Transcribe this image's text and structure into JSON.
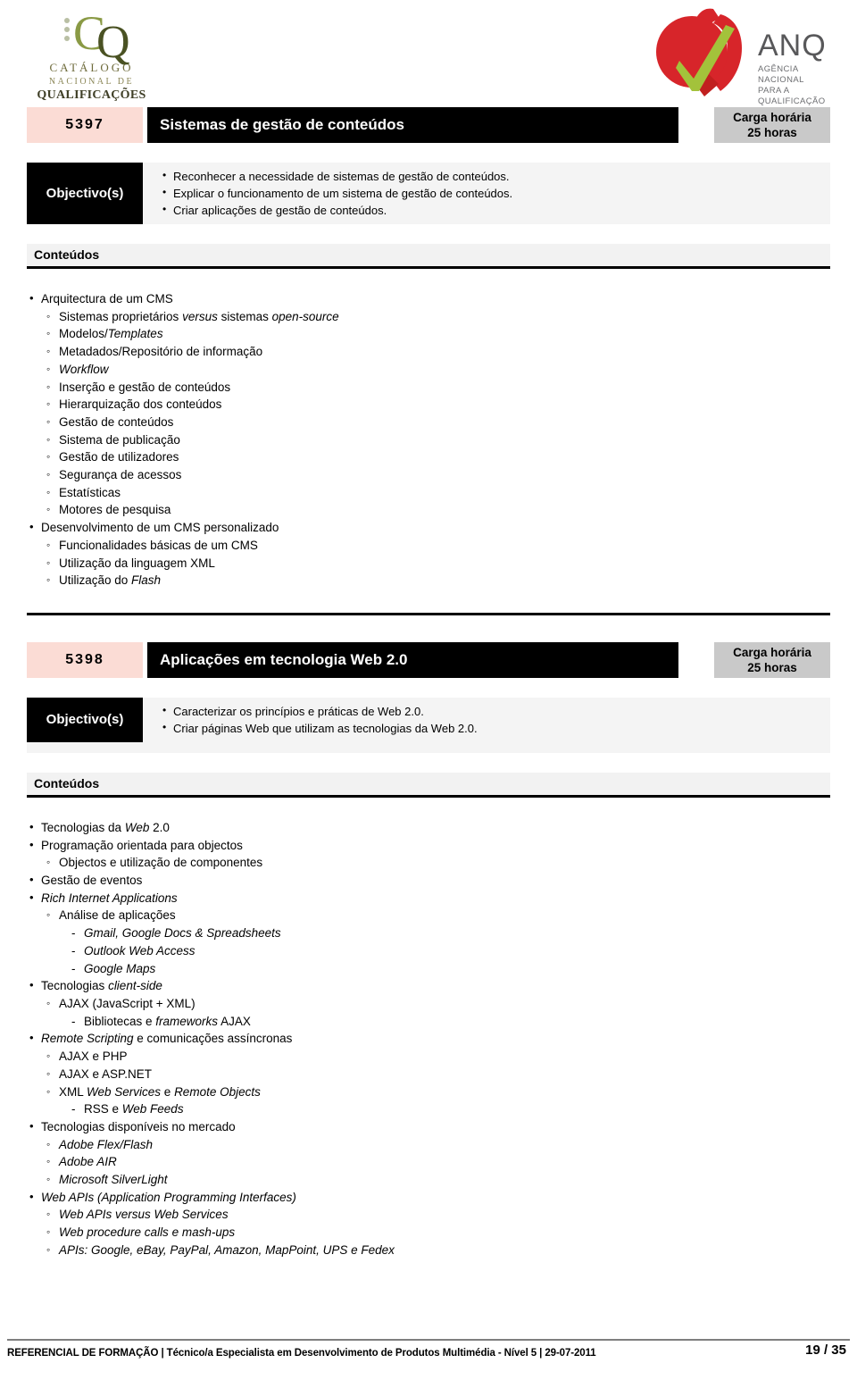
{
  "header": {
    "cnq_logo": {
      "mark_letters": "CQ",
      "line1": "CATÁLOGO",
      "line2": "NACIONAL DE",
      "line3": "QUALIFICAÇÕES"
    },
    "anq_logo": {
      "name": "ANQ",
      "sub1": "AGÊNCIA NACIONAL",
      "sub2": "PARA A QUALIFICAÇÃO"
    }
  },
  "colors": {
    "code_box": "#fbdcd5",
    "title_bar": "#000000",
    "hours_box": "#c9c9c9",
    "objective_box": "#000000",
    "objective_row": "#f4f4f4",
    "contents_head": "#f2f2f2",
    "cnq_green": "#8a9a45",
    "anq_red": "#d7252a",
    "anq_green": "#a3c23b"
  },
  "labels": {
    "objectives": "Objectivo(s)",
    "contents": "Conteúdos",
    "hours_label": "Carga horária"
  },
  "modules": [
    {
      "code": "5397",
      "title": "Sistemas de gestão de conteúdos",
      "hours_label": "Carga horária",
      "hours_value": "25 horas",
      "objectives_label": "Objectivo(s)",
      "objectives": [
        "Reconhecer a necessidade de sistemas de gestão de conteúdos.",
        "Explicar o funcionamento de um sistema de gestão de conteúdos.",
        "Criar aplicações de gestão de conteúdos."
      ],
      "contents_label": "Conteúdos",
      "contents": [
        {
          "level": 1,
          "html": "Arquitectura de um CMS"
        },
        {
          "level": 2,
          "html": "Sistemas proprietários <span class=\"it\">versus</span> sistemas <span class=\"it\">open-source</span>"
        },
        {
          "level": 2,
          "html": "Modelos/<span class=\"it\">Templates</span>"
        },
        {
          "level": 2,
          "html": "Metadados/Repositório de informação"
        },
        {
          "level": 2,
          "html": "<span class=\"it\">Workflow</span>"
        },
        {
          "level": 2,
          "html": "Inserção e gestão de conteúdos"
        },
        {
          "level": 2,
          "html": "Hierarquização dos conteúdos"
        },
        {
          "level": 2,
          "html": "Gestão de conteúdos"
        },
        {
          "level": 2,
          "html": "Sistema de publicação"
        },
        {
          "level": 2,
          "html": "Gestão de utilizadores"
        },
        {
          "level": 2,
          "html": "Segurança de acessos"
        },
        {
          "level": 2,
          "html": "Estatísticas"
        },
        {
          "level": 2,
          "html": "Motores de pesquisa"
        },
        {
          "level": 1,
          "html": "Desenvolvimento de um CMS personalizado"
        },
        {
          "level": 2,
          "html": "Funcionalidades básicas de um CMS"
        },
        {
          "level": 2,
          "html": "Utilização da linguagem XML"
        },
        {
          "level": 2,
          "html": "Utilização do <span class=\"it\">Flash</span>"
        }
      ]
    },
    {
      "code": "5398",
      "title": "Aplicações em tecnologia Web 2.0",
      "hours_label": "Carga horária",
      "hours_value": "25 horas",
      "objectives_label": "Objectivo(s)",
      "objectives": [
        "Caracterizar os princípios e práticas de Web 2.0.",
        "Criar páginas Web que utilizam as tecnologias da Web 2.0."
      ],
      "contents_label": "Conteúdos",
      "contents": [
        {
          "level": 1,
          "html": "Tecnologias da <span class=\"it\">Web</span> 2.0"
        },
        {
          "level": 1,
          "html": "Programação orientada para objectos"
        },
        {
          "level": 2,
          "html": "Objectos e utilização de componentes"
        },
        {
          "level": 1,
          "html": "Gestão de eventos"
        },
        {
          "level": 1,
          "html": "<span class=\"it\">Rich Internet Applications</span>"
        },
        {
          "level": 2,
          "html": "Análise de aplicações"
        },
        {
          "level": 3,
          "html": "<span class=\"it\">Gmail, Google Docs &amp; Spreadsheets</span>"
        },
        {
          "level": 3,
          "html": "<span class=\"it\">Outlook Web Access</span>"
        },
        {
          "level": 3,
          "html": "<span class=\"it\">Google Maps</span>"
        },
        {
          "level": 1,
          "html": "Tecnologias <span class=\"it\">client-side</span>"
        },
        {
          "level": 2,
          "html": "AJAX (JavaScript + XML)"
        },
        {
          "level": 3,
          "html": "Bibliotecas e <span class=\"it\">frameworks</span> AJAX"
        },
        {
          "level": 1,
          "html": "<span class=\"it\">Remote Scripting</span> e comunicações assíncronas"
        },
        {
          "level": 2,
          "html": "AJAX e PHP"
        },
        {
          "level": 2,
          "html": "AJAX e ASP.NET"
        },
        {
          "level": 2,
          "html": "XML <span class=\"it\">Web Services</span> e <span class=\"it\">Remote Objects</span>"
        },
        {
          "level": 3,
          "html": "RSS e <span class=\"it\">Web Feeds</span>"
        },
        {
          "level": 1,
          "html": "Tecnologias disponíveis no mercado"
        },
        {
          "level": 2,
          "html": "<span class=\"it\">Adobe Flex/Flash</span>"
        },
        {
          "level": 2,
          "html": "<span class=\"it\">Adobe AIR</span>"
        },
        {
          "level": 2,
          "html": "<span class=\"it\">Microsoft SilverLight</span>"
        },
        {
          "level": 1,
          "html": "<span class=\"it\">Web APIs (Application Programming Interfaces)</span>"
        },
        {
          "level": 2,
          "html": "<span class=\"it\">Web APIs versus Web Services</span>"
        },
        {
          "level": 2,
          "html": "<span class=\"it\">Web procedure calls e mash-ups</span>"
        },
        {
          "level": 2,
          "html": "<span class=\"it\">APIs: Google, eBay, PayPal, Amazon, MapPoint, UPS e Fedex</span>"
        }
      ]
    }
  ],
  "footer": {
    "text": "REFERENCIAL DE FORMAÇÃO | Técnico/a Especialista em Desenvolvimento de Produtos Multimédia - Nível 5 | 29-07-2011",
    "page": "19 / 35"
  }
}
